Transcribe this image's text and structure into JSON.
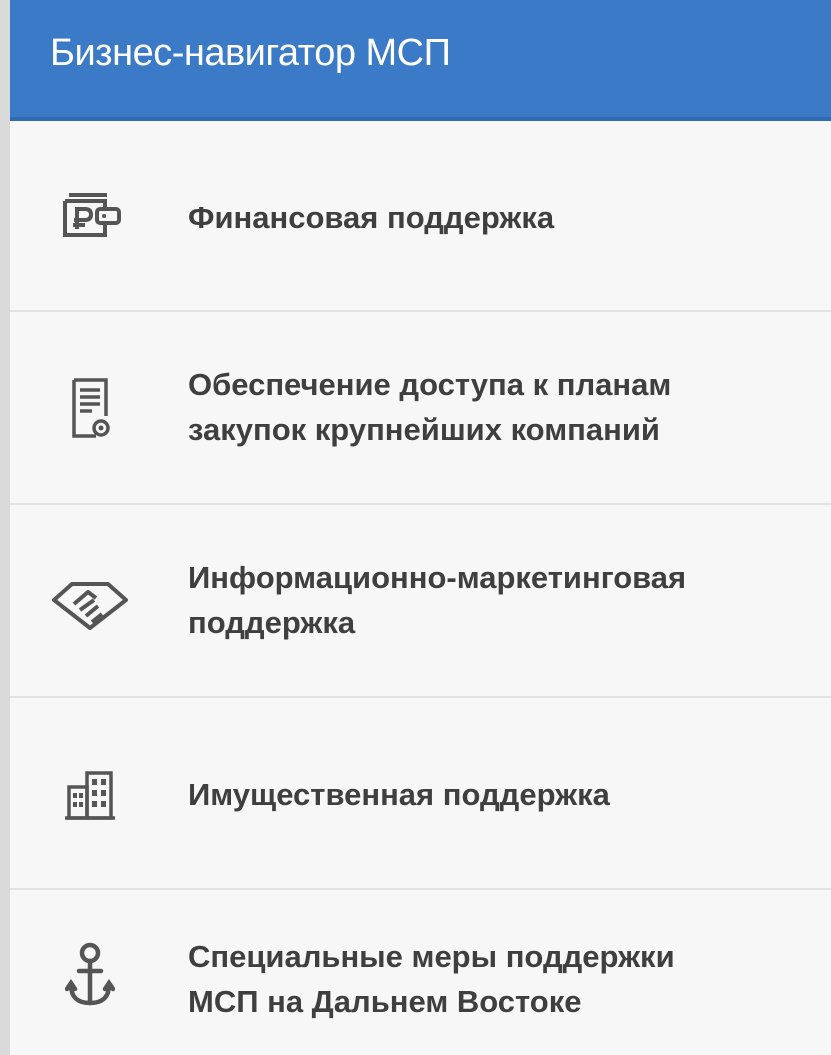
{
  "header": {
    "title": "Бизнес-навигатор МСП"
  },
  "menu": {
    "items": [
      {
        "icon": "ruble-wallet-icon",
        "lines": [
          "Финансовая поддержка"
        ]
      },
      {
        "icon": "procurement-document-icon",
        "lines": [
          "Обеспечение доступа к планам",
          "закупок крупнейших компаний"
        ]
      },
      {
        "icon": "handshake-icon",
        "lines": [
          "Информационно-маркетинговая",
          "поддержка"
        ]
      },
      {
        "icon": "buildings-icon",
        "lines": [
          "Имущественная поддержка"
        ]
      },
      {
        "icon": "anchor-icon",
        "lines": [
          "Специальные меры поддержки",
          "МСП на Дальнем Востоке"
        ]
      }
    ]
  },
  "colors": {
    "header_bg": "#3b7ac7",
    "panel_bg": "#f7f7f7",
    "text": "#3f3f3f",
    "icon": "#555555"
  }
}
